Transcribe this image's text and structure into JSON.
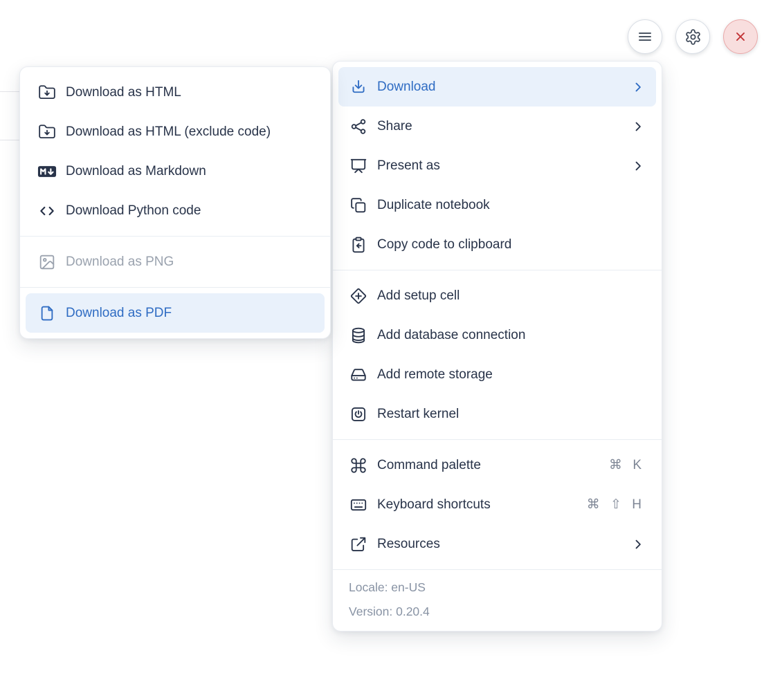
{
  "toolbar": {
    "buttons": [
      {
        "name": "notebook-menu",
        "icon": "hamburger-icon"
      },
      {
        "name": "settings",
        "icon": "gear-icon"
      },
      {
        "name": "shutdown",
        "icon": "close-icon",
        "accent": "#c23537"
      }
    ]
  },
  "colors": {
    "accent_blue": "#2f6cc3",
    "highlight_bg": "#e9f1fb",
    "text": "#283349",
    "muted": "#8893a4",
    "disabled": "#9aa2ae",
    "danger_bg": "#f8dede",
    "danger": "#c23537"
  },
  "submenu": {
    "groups": [
      {
        "items": [
          {
            "label": "Download as HTML",
            "icon": "folder-download-icon"
          },
          {
            "label": "Download as HTML (exclude code)",
            "icon": "folder-download-icon"
          },
          {
            "label": "Download as Markdown",
            "icon": "markdown-icon"
          },
          {
            "label": "Download Python code",
            "icon": "code-icon"
          }
        ]
      },
      {
        "items": [
          {
            "label": "Download as PNG",
            "icon": "image-icon",
            "disabled": true
          }
        ]
      },
      {
        "items": [
          {
            "label": "Download as PDF",
            "icon": "file-icon",
            "highlighted": true
          }
        ]
      }
    ]
  },
  "menu": {
    "groups": [
      {
        "items": [
          {
            "label": "Download",
            "icon": "download-icon",
            "submenu": true,
            "highlighted": true
          },
          {
            "label": "Share",
            "icon": "share-icon",
            "submenu": true
          },
          {
            "label": "Present as",
            "icon": "presentation-icon",
            "submenu": true
          },
          {
            "label": "Duplicate notebook",
            "icon": "duplicate-icon"
          },
          {
            "label": "Copy code to clipboard",
            "icon": "clipboard-copy-icon"
          }
        ]
      },
      {
        "items": [
          {
            "label": "Add setup cell",
            "icon": "diamond-plus-icon"
          },
          {
            "label": "Add database connection",
            "icon": "database-icon"
          },
          {
            "label": "Add remote storage",
            "icon": "hard-drive-icon"
          },
          {
            "label": "Restart kernel",
            "icon": "power-square-icon"
          }
        ]
      },
      {
        "items": [
          {
            "label": "Command palette",
            "icon": "command-icon",
            "shortcut": "⌘ K"
          },
          {
            "label": "Keyboard shortcuts",
            "icon": "keyboard-icon",
            "shortcut": "⌘ ⇧ H"
          },
          {
            "label": "Resources",
            "icon": "external-link-icon",
            "submenu": true
          }
        ]
      }
    ],
    "footer": {
      "locale": "Locale: en-US",
      "version": "Version: 0.20.4"
    }
  }
}
